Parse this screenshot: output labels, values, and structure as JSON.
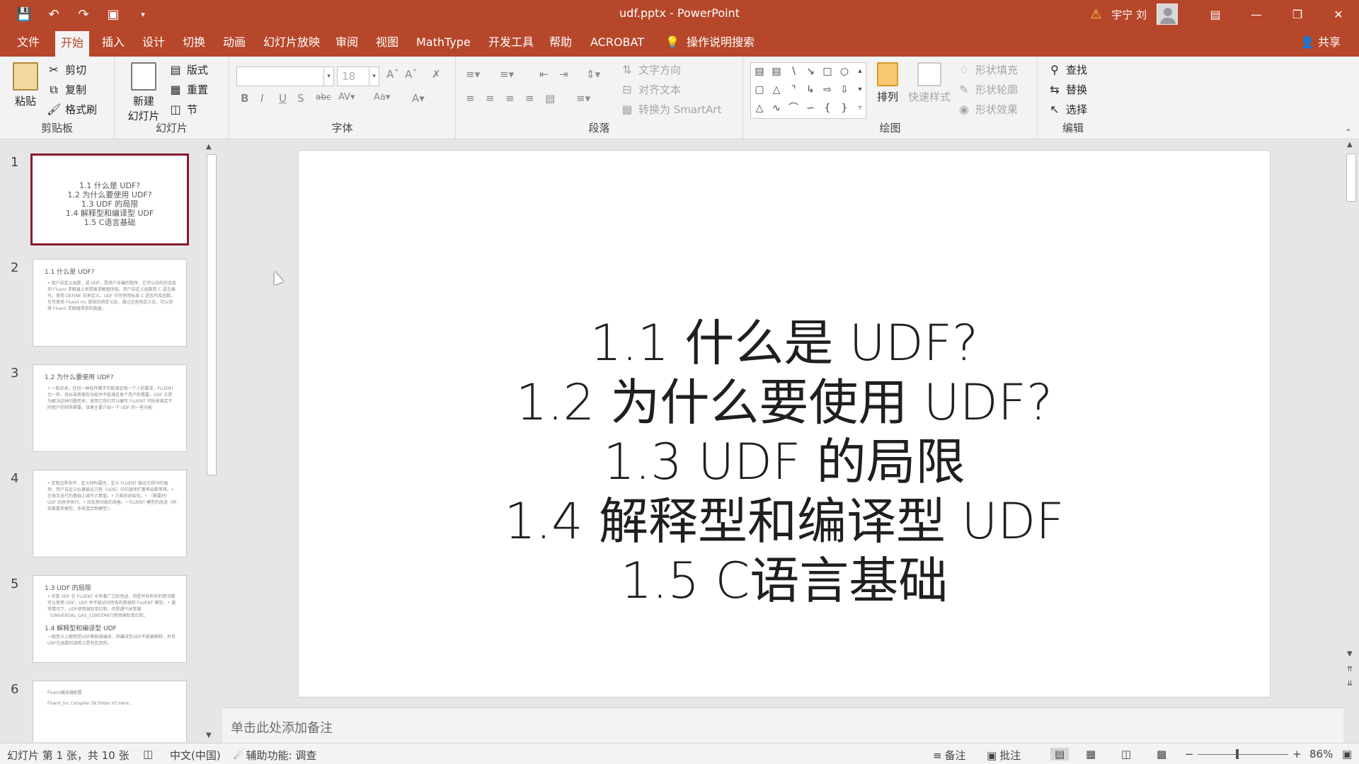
{
  "titlebar": {
    "title": "udf.pptx  -  PowerPoint",
    "user": "宇宁 刘",
    "qat": [
      "save-icon",
      "undo-icon",
      "redo-icon",
      "present-icon",
      "customize-icon"
    ]
  },
  "tabs": [
    {
      "label": "文件"
    },
    {
      "label": "开始"
    },
    {
      "label": "插入"
    },
    {
      "label": "设计"
    },
    {
      "label": "切换"
    },
    {
      "label": "动画"
    },
    {
      "label": "幻灯片放映"
    },
    {
      "label": "审阅"
    },
    {
      "label": "视图"
    },
    {
      "label": "MathType"
    },
    {
      "label": "开发工具"
    },
    {
      "label": "帮助"
    },
    {
      "label": "ACROBAT"
    },
    {
      "label": "操作说明搜索"
    }
  ],
  "share": "共享",
  "ribbon": {
    "clipboard": {
      "paste": "粘贴",
      "cut": "剪切",
      "copy": "复制",
      "painter": "格式刷",
      "label": "剪贴板"
    },
    "slides": {
      "new_line1": "新建",
      "new_line2": "幻灯片",
      "layout": "版式",
      "reset": "重置",
      "section": "节",
      "label": "幻灯片"
    },
    "font": {
      "size": "18",
      "label": "字体"
    },
    "paragraph": {
      "text_dir": "文字方向",
      "align_text": "对齐文本",
      "smartart": "转换为 SmartArt",
      "label": "段落"
    },
    "drawing": {
      "arrange": "排列",
      "quick_styles": "快速样式",
      "fill": "形状填充",
      "outline": "形状轮廓",
      "effects": "形状效果",
      "label": "绘图"
    },
    "editing": {
      "find": "查找",
      "replace": "替换",
      "select": "选择",
      "label": "编辑"
    }
  },
  "thumbs": [
    {
      "num": "1",
      "lines": [
        "1.1 什么是 UDF?",
        "1.2 为什么要使用 UDF?",
        "1.3 UDF 的局限",
        "1.4 解释型和编译型 UDF",
        "1.5 C语言基础"
      ]
    },
    {
      "num": "2",
      "title": "1.1 什么是 UDF?",
      "body": "• 用户自定义函数，或 UDF，是用户自编的程序，它可以动态的连接到 Fluent 求解器上来提高求解器性能。用户自定义函数用 C 语言编写。使用 DEFINE 宏来定义。UDF 中可使用标准 C 语言的库函数，也可使用 Fluent Inc 提供的预定义宏，通过这些预定义宏，可以获得 Fluent 求解器得到的数据。"
    },
    {
      "num": "3",
      "title": "1.2 为什么要使用 UDF?",
      "body": "• 一般说来，任何一种软件都不可能满足每一个人的要求，FLUENT 也一样，其标准界面及功能并不能满足每个用户的需要。UDF 正是为解决这种问题而来，使用它我们可以编写 FLUENT 代码来满足不同用户的特殊需要。该章主要介绍一下 UDF 的一些功能"
    },
    {
      "num": "4",
      "title": "",
      "body": "• 定制边界条件，定义材料属性，定义 FLUENT 输运方程中的源项，用户自定义标量输运方程（UDS）中的源项扩散率函数等等。• 在每次迭代的基础上调节计算值。• 方案的初始化。• （需要时）UDF 的异步执行。• 后处理功能的改善。• FLUENT 模型的改进（例如离散项模型，多项混合物模型）。"
    },
    {
      "num": "5",
      "title": "1.3 UDF 的局限",
      "body": "• 尽管 UDF 在 FLUENT 中有着广泛的用途，但是并非所有的情况都可以使用 UDF。UDF 并不能访问所有的数据和 FLUENT 模型。• 通常情况下，UDF使用国际单位制，但是遇气体常量（UNIVERSAL_GAS_CONSTANT)使用国际单位制。",
      "title2": "1.4 解释型和编译型 UDF",
      "body2": "一般意义上解释型UDF都能被编译，但编译型UDF不能被解释，并且UDF在函数的调用上是有区别的。"
    },
    {
      "num": "6",
      "title": "Fluent编译器配置",
      "body": "Fluent_Inc Compiler Ok folder VS Here..."
    }
  ],
  "slide": {
    "lines": [
      "1.1 什么是 UDF?",
      "1.2 为什么要使用 UDF?",
      "1.3 UDF 的局限",
      "1.4 解释型和编译型 UDF",
      "1.5 C语言基础"
    ]
  },
  "notes_placeholder": "单击此处添加备注",
  "status": {
    "slide_info": "幻灯片 第 1 张，共 10 张",
    "language": "中文(中国)",
    "accessibility": "辅助功能: 调查",
    "notes": "备注",
    "comments": "批注",
    "zoom": "86%"
  },
  "colors": {
    "accent": "#b7472a",
    "selected_thumb": "#8b1a2c"
  }
}
